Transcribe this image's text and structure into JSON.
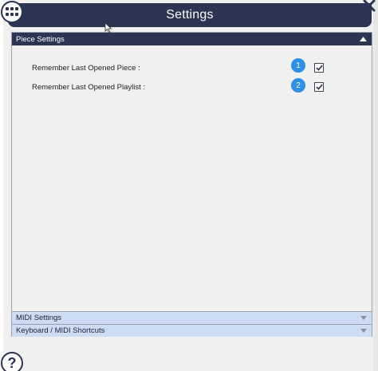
{
  "window": {
    "title": "Settings"
  },
  "icons": {
    "grid": "grid-icon",
    "close": "close-icon",
    "help": "help-icon",
    "chevron_up": "chevron-up-icon",
    "chevron_down": "chevron-down-icon",
    "check": "check-icon"
  },
  "colors": {
    "title_bar": "#2b3553",
    "section_open": "#2b3553",
    "section_closed": "#cddcf5",
    "badge": "#2d8fe8"
  },
  "sections": {
    "piece_settings": {
      "label": "Piece Settings",
      "expanded": true,
      "rows": [
        {
          "label": "Remember Last Opened Piece :",
          "badge": "1",
          "checked": true
        },
        {
          "label": "Remember Last Opened Playlist :",
          "badge": "2",
          "checked": true
        }
      ]
    },
    "midi_settings": {
      "label": "MIDI Settings",
      "expanded": false
    },
    "shortcuts": {
      "label": "Keyboard / MIDI Shortcuts",
      "expanded": false
    }
  },
  "help": {
    "label": "?"
  }
}
